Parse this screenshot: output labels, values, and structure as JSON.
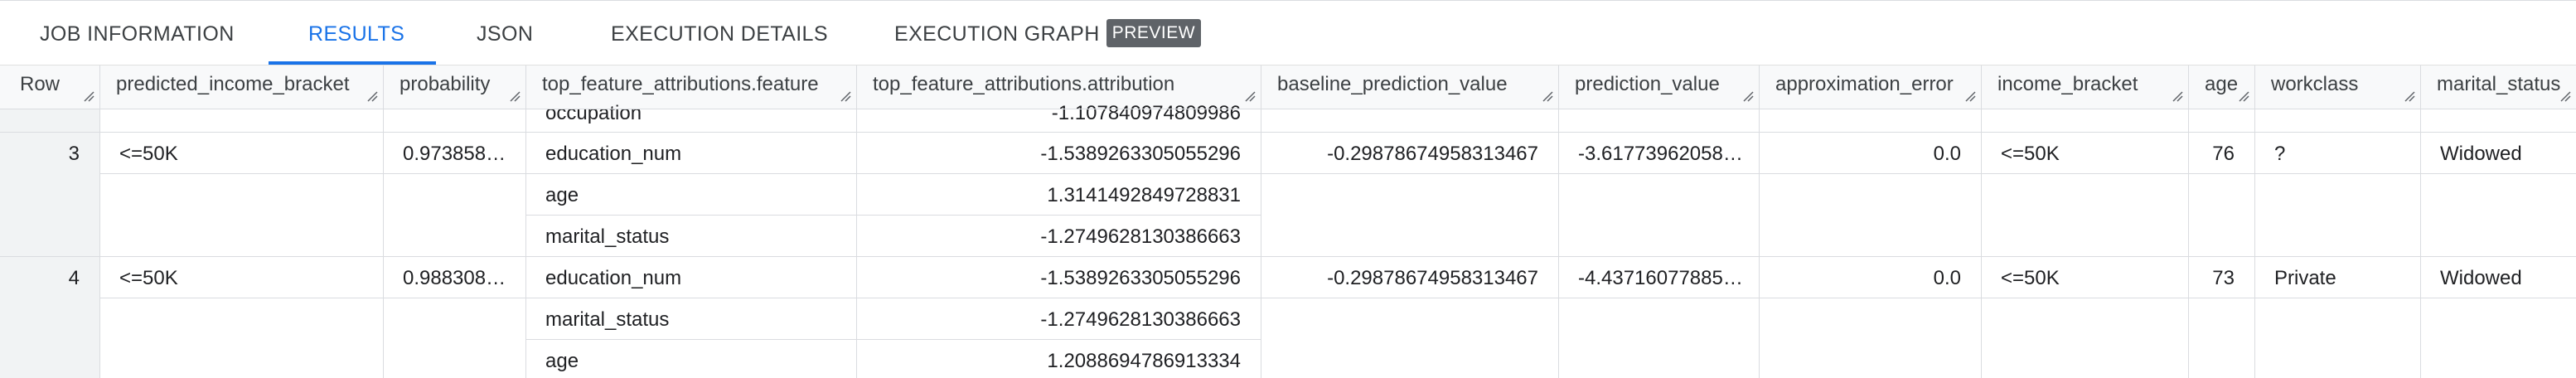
{
  "tabs": {
    "job_information": "JOB INFORMATION",
    "results": "RESULTS",
    "json": "JSON",
    "execution_details": "EXECUTION DETAILS",
    "execution_graph": "EXECUTION GRAPH",
    "preview_badge": "PREVIEW"
  },
  "columns": [
    "Row",
    "predicted_income_bracket",
    "probability",
    "top_feature_attributions.feature",
    "top_feature_attributions.attribution",
    "baseline_prediction_value",
    "prediction_value",
    "approximation_error",
    "income_bracket",
    "age",
    "workclass",
    "marital_status"
  ],
  "partial_row": {
    "feature": "occupation",
    "attribution": "-1.107840974809986"
  },
  "rows": [
    {
      "row": "3",
      "predicted_income_bracket": "<=50K",
      "probability": "0.973858…",
      "attributions": [
        {
          "feature": "education_num",
          "attribution": "-1.5389263305055296"
        },
        {
          "feature": "age",
          "attribution": "1.3141492849728831"
        },
        {
          "feature": "marital_status",
          "attribution": "-1.2749628130386663"
        }
      ],
      "baseline_prediction_value": "-0.29878674958313467",
      "prediction_value": "-3.61773962058…",
      "approximation_error": "0.0",
      "income_bracket": "<=50K",
      "age": "76",
      "workclass": "?",
      "marital_status": "Widowed"
    },
    {
      "row": "4",
      "predicted_income_bracket": "<=50K",
      "probability": "0.988308…",
      "attributions": [
        {
          "feature": "education_num",
          "attribution": "-1.5389263305055296"
        },
        {
          "feature": "marital_status",
          "attribution": "-1.2749628130386663"
        },
        {
          "feature": "age",
          "attribution": "1.2088694786913334"
        }
      ],
      "baseline_prediction_value": "-0.29878674958313467",
      "prediction_value": "-4.43716077885…",
      "approximation_error": "0.0",
      "income_bracket": "<=50K",
      "age": "73",
      "workclass": "Private",
      "marital_status": "Widowed"
    }
  ],
  "colors": {
    "accent": "#1a73e8",
    "border": "#dadce0",
    "header_bg": "#f8f9fa",
    "badge_bg": "#5f6368"
  }
}
